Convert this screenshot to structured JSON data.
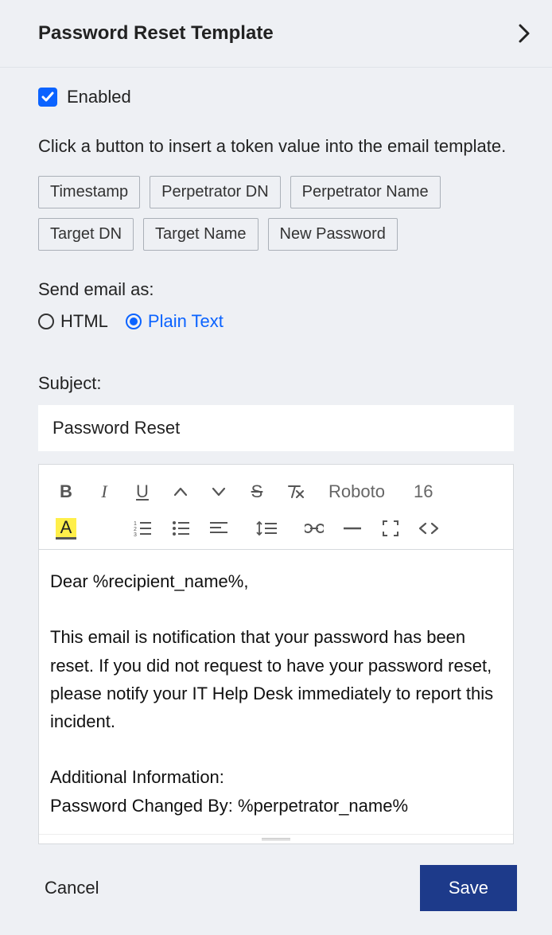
{
  "header": {
    "title": "Password Reset Template"
  },
  "enabled": {
    "label": "Enabled",
    "checked": true
  },
  "hint": "Click a button to insert a token value into the email template.",
  "tokens_row1": [
    "Timestamp",
    "Perpetrator DN",
    "Perpetrator Name"
  ],
  "tokens_row2": [
    "Target DN",
    "Target Name",
    "New Password"
  ],
  "send_as": {
    "label": "Send email as:",
    "options": {
      "html": "HTML",
      "plain": "Plain Text"
    },
    "selected": "plain"
  },
  "subject": {
    "label": "Subject:",
    "value": "Password Reset"
  },
  "toolbar": {
    "font_name": "Roboto",
    "font_size": "16"
  },
  "editor_body": "Dear %recipient_name%,\n\nThis email is notification that your password has been reset.  If you did not request to have your password reset, please notify your IT Help Desk immediately to report this incident.\n\nAdditional Information:\nPassword Changed By: %perpetrator_name%",
  "footer": {
    "cancel": "Cancel",
    "save": "Save"
  }
}
